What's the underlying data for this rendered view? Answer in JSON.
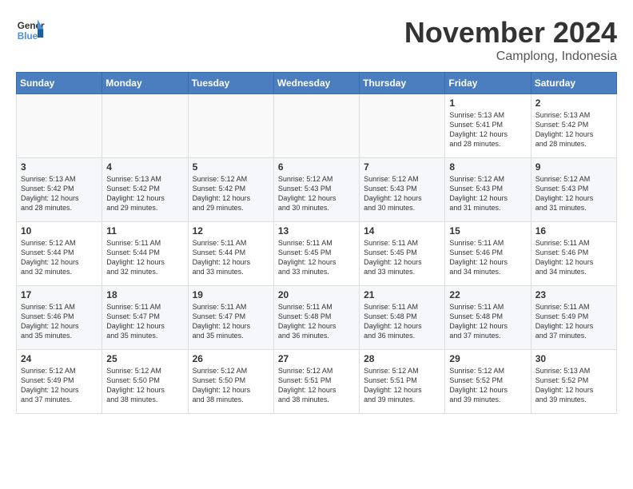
{
  "header": {
    "logo_line1": "General",
    "logo_line2": "Blue",
    "month": "November 2024",
    "location": "Camplong, Indonesia"
  },
  "weekdays": [
    "Sunday",
    "Monday",
    "Tuesday",
    "Wednesday",
    "Thursday",
    "Friday",
    "Saturday"
  ],
  "weeks": [
    [
      {
        "day": "",
        "info": ""
      },
      {
        "day": "",
        "info": ""
      },
      {
        "day": "",
        "info": ""
      },
      {
        "day": "",
        "info": ""
      },
      {
        "day": "",
        "info": ""
      },
      {
        "day": "1",
        "info": "Sunrise: 5:13 AM\nSunset: 5:41 PM\nDaylight: 12 hours\nand 28 minutes."
      },
      {
        "day": "2",
        "info": "Sunrise: 5:13 AM\nSunset: 5:42 PM\nDaylight: 12 hours\nand 28 minutes."
      }
    ],
    [
      {
        "day": "3",
        "info": "Sunrise: 5:13 AM\nSunset: 5:42 PM\nDaylight: 12 hours\nand 28 minutes."
      },
      {
        "day": "4",
        "info": "Sunrise: 5:13 AM\nSunset: 5:42 PM\nDaylight: 12 hours\nand 29 minutes."
      },
      {
        "day": "5",
        "info": "Sunrise: 5:12 AM\nSunset: 5:42 PM\nDaylight: 12 hours\nand 29 minutes."
      },
      {
        "day": "6",
        "info": "Sunrise: 5:12 AM\nSunset: 5:43 PM\nDaylight: 12 hours\nand 30 minutes."
      },
      {
        "day": "7",
        "info": "Sunrise: 5:12 AM\nSunset: 5:43 PM\nDaylight: 12 hours\nand 30 minutes."
      },
      {
        "day": "8",
        "info": "Sunrise: 5:12 AM\nSunset: 5:43 PM\nDaylight: 12 hours\nand 31 minutes."
      },
      {
        "day": "9",
        "info": "Sunrise: 5:12 AM\nSunset: 5:43 PM\nDaylight: 12 hours\nand 31 minutes."
      }
    ],
    [
      {
        "day": "10",
        "info": "Sunrise: 5:12 AM\nSunset: 5:44 PM\nDaylight: 12 hours\nand 32 minutes."
      },
      {
        "day": "11",
        "info": "Sunrise: 5:11 AM\nSunset: 5:44 PM\nDaylight: 12 hours\nand 32 minutes."
      },
      {
        "day": "12",
        "info": "Sunrise: 5:11 AM\nSunset: 5:44 PM\nDaylight: 12 hours\nand 33 minutes."
      },
      {
        "day": "13",
        "info": "Sunrise: 5:11 AM\nSunset: 5:45 PM\nDaylight: 12 hours\nand 33 minutes."
      },
      {
        "day": "14",
        "info": "Sunrise: 5:11 AM\nSunset: 5:45 PM\nDaylight: 12 hours\nand 33 minutes."
      },
      {
        "day": "15",
        "info": "Sunrise: 5:11 AM\nSunset: 5:46 PM\nDaylight: 12 hours\nand 34 minutes."
      },
      {
        "day": "16",
        "info": "Sunrise: 5:11 AM\nSunset: 5:46 PM\nDaylight: 12 hours\nand 34 minutes."
      }
    ],
    [
      {
        "day": "17",
        "info": "Sunrise: 5:11 AM\nSunset: 5:46 PM\nDaylight: 12 hours\nand 35 minutes."
      },
      {
        "day": "18",
        "info": "Sunrise: 5:11 AM\nSunset: 5:47 PM\nDaylight: 12 hours\nand 35 minutes."
      },
      {
        "day": "19",
        "info": "Sunrise: 5:11 AM\nSunset: 5:47 PM\nDaylight: 12 hours\nand 35 minutes."
      },
      {
        "day": "20",
        "info": "Sunrise: 5:11 AM\nSunset: 5:48 PM\nDaylight: 12 hours\nand 36 minutes."
      },
      {
        "day": "21",
        "info": "Sunrise: 5:11 AM\nSunset: 5:48 PM\nDaylight: 12 hours\nand 36 minutes."
      },
      {
        "day": "22",
        "info": "Sunrise: 5:11 AM\nSunset: 5:48 PM\nDaylight: 12 hours\nand 37 minutes."
      },
      {
        "day": "23",
        "info": "Sunrise: 5:11 AM\nSunset: 5:49 PM\nDaylight: 12 hours\nand 37 minutes."
      }
    ],
    [
      {
        "day": "24",
        "info": "Sunrise: 5:12 AM\nSunset: 5:49 PM\nDaylight: 12 hours\nand 37 minutes."
      },
      {
        "day": "25",
        "info": "Sunrise: 5:12 AM\nSunset: 5:50 PM\nDaylight: 12 hours\nand 38 minutes."
      },
      {
        "day": "26",
        "info": "Sunrise: 5:12 AM\nSunset: 5:50 PM\nDaylight: 12 hours\nand 38 minutes."
      },
      {
        "day": "27",
        "info": "Sunrise: 5:12 AM\nSunset: 5:51 PM\nDaylight: 12 hours\nand 38 minutes."
      },
      {
        "day": "28",
        "info": "Sunrise: 5:12 AM\nSunset: 5:51 PM\nDaylight: 12 hours\nand 39 minutes."
      },
      {
        "day": "29",
        "info": "Sunrise: 5:12 AM\nSunset: 5:52 PM\nDaylight: 12 hours\nand 39 minutes."
      },
      {
        "day": "30",
        "info": "Sunrise: 5:13 AM\nSunset: 5:52 PM\nDaylight: 12 hours\nand 39 minutes."
      }
    ]
  ]
}
